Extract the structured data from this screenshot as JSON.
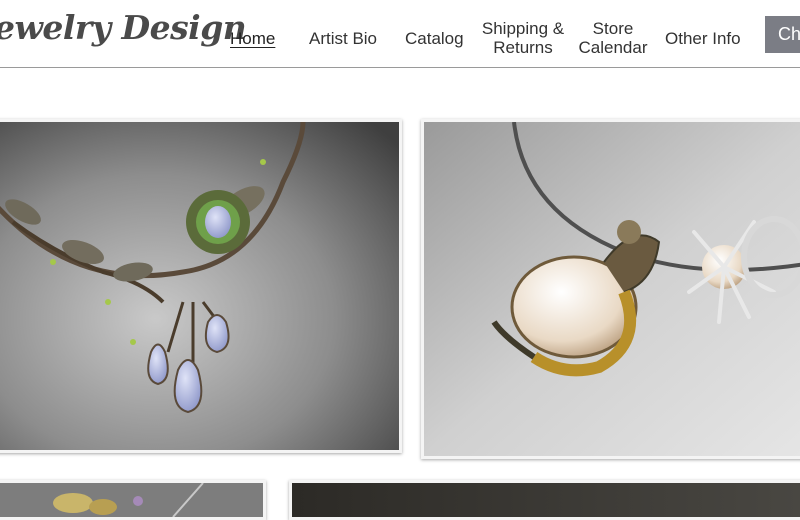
{
  "header": {
    "logo_text": "ewelry Design",
    "nav": [
      {
        "label": "Home",
        "active": true
      },
      {
        "label": "Artist Bio"
      },
      {
        "label": "Catalog"
      },
      {
        "label": "Shipping &\nReturns"
      },
      {
        "label": "Store\nCalendar"
      },
      {
        "label": "Other Info"
      }
    ],
    "cta_label": "Ch"
  },
  "gallery": {
    "tiles": [
      {
        "icon": "necklace-photo"
      },
      {
        "icon": "mermaid-pendant-photo"
      },
      {
        "icon": "jewelry-photo"
      },
      {
        "icon": "jewelry-photo"
      }
    ]
  },
  "colors": {
    "header_bg": "#ffffff",
    "nav_text": "#333333",
    "logo_text": "#4a4a4a",
    "cta_bg": "#7b7d85",
    "divider": "#9a9a9a"
  }
}
